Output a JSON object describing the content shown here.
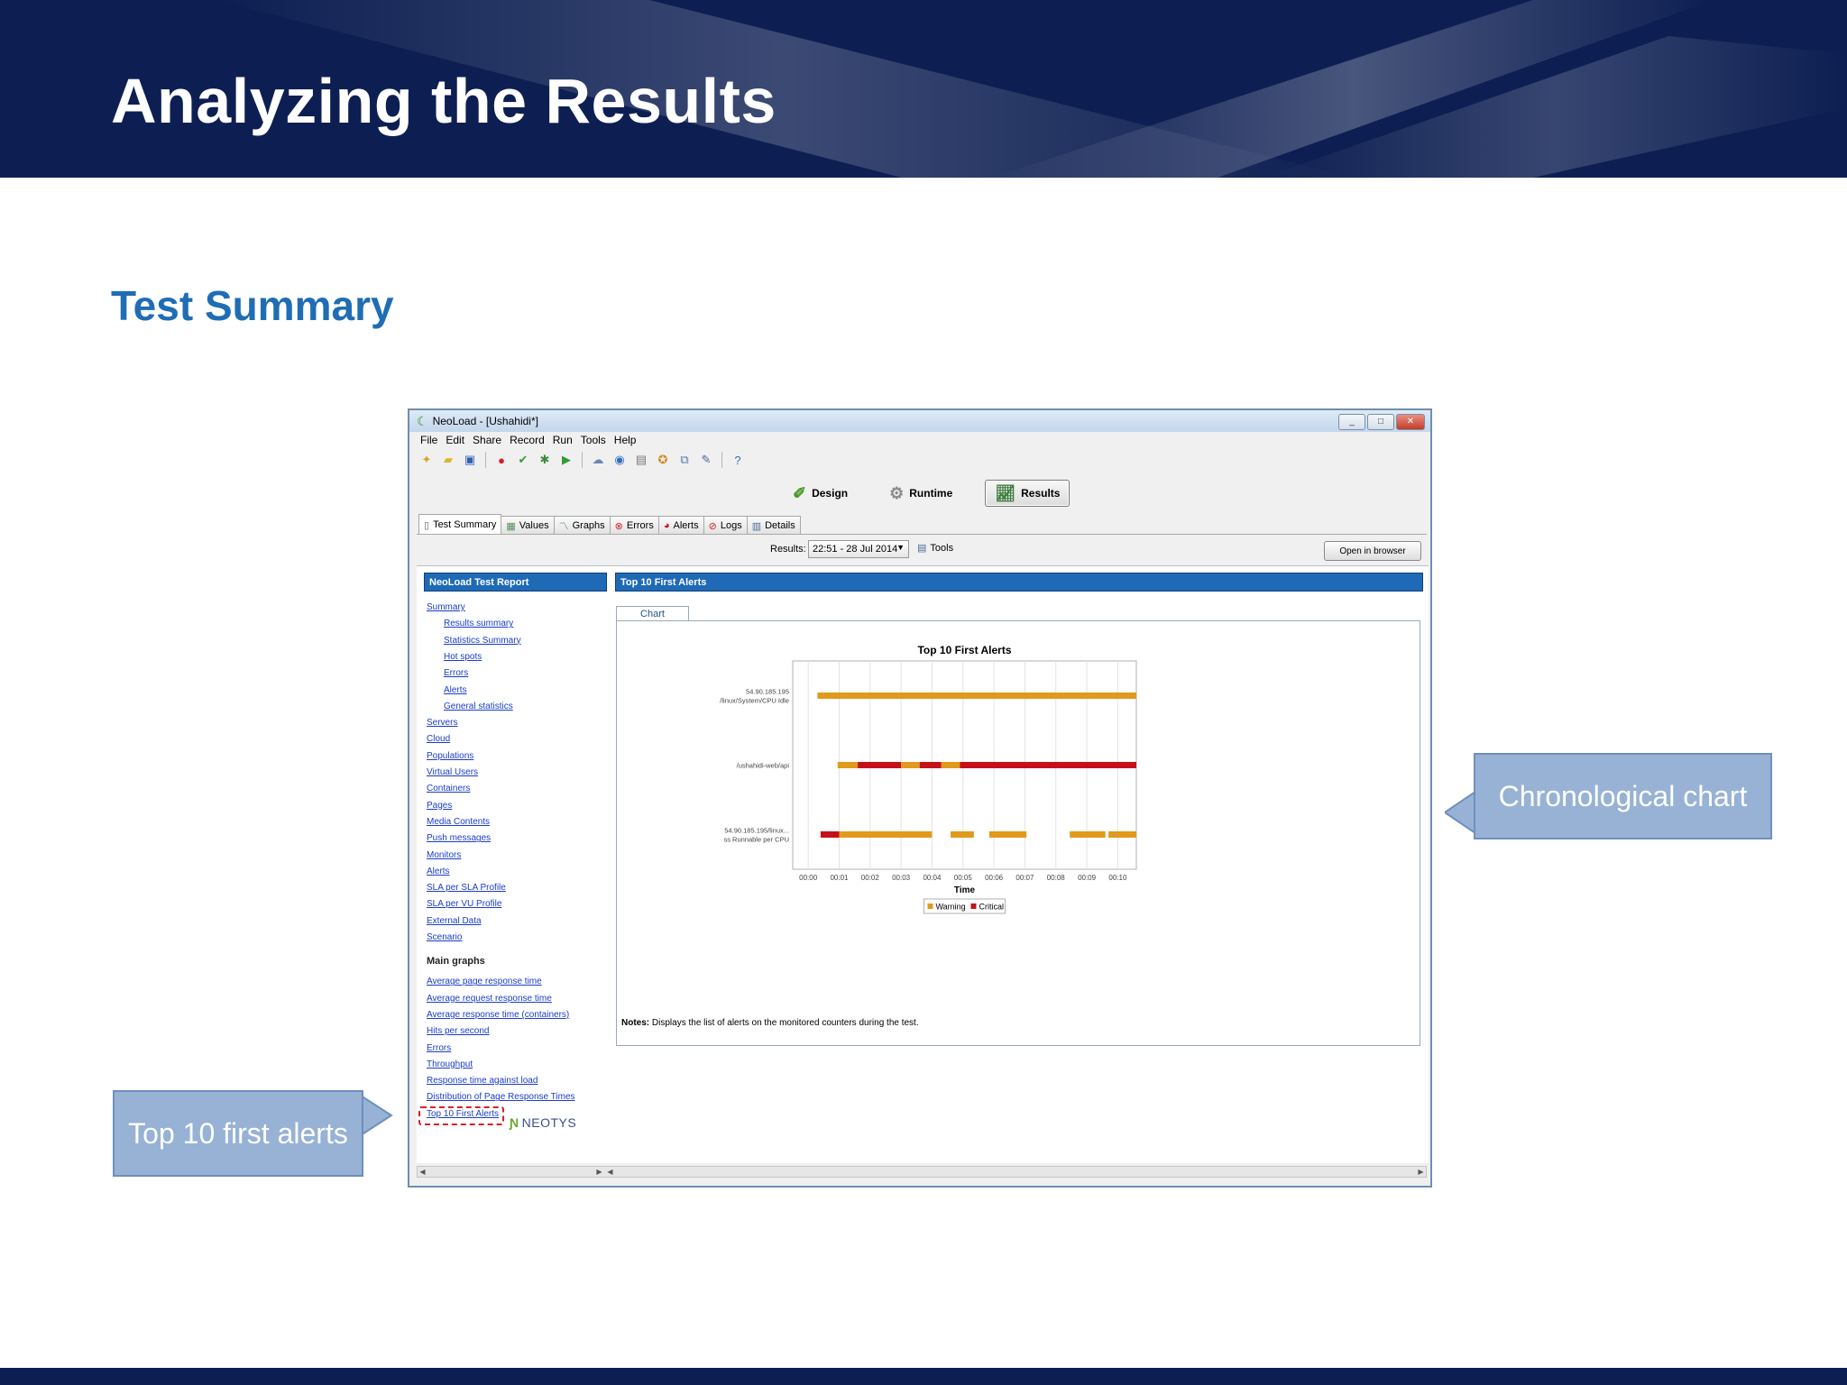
{
  "slide": {
    "title": "Analyzing the Results",
    "subtitle": "Test Summary",
    "callout_right": "Chronological chart",
    "callout_left": "Top 10 first alerts"
  },
  "window": {
    "title": "NeoLoad - [Ushahidi*]",
    "controls": [
      "_",
      "□",
      "✕"
    ]
  },
  "menu": [
    "File",
    "Edit",
    "Share",
    "Record",
    "Run",
    "Tools",
    "Help"
  ],
  "toolbar_icons": [
    "new-icon",
    "open-icon",
    "save-icon",
    "record-icon",
    "check-icon",
    "settings-icon",
    "play-icon",
    "cloud-icon",
    "globe-icon",
    "report-icon",
    "ribbon-icon",
    "compare-icon",
    "edit-icon",
    "help-icon"
  ],
  "modes": {
    "design": "Design",
    "runtime": "Runtime",
    "results": "Results"
  },
  "tabs": [
    "Test Summary",
    "Values",
    "Graphs",
    "Errors",
    "Alerts",
    "Logs",
    "Details"
  ],
  "results_bar": {
    "label": "Results:",
    "selected": "22:51 - 28 Jul 2014",
    "tools": "Tools",
    "open_browser": "Open in browser"
  },
  "left_panel": {
    "header": "NeoLoad Test Report",
    "nav": [
      {
        "label": "Summary",
        "sub": false
      },
      {
        "label": "Results summary",
        "sub": true
      },
      {
        "label": "Statistics Summary",
        "sub": true
      },
      {
        "label": "Hot spots",
        "sub": true
      },
      {
        "label": "Errors",
        "sub": true
      },
      {
        "label": "Alerts",
        "sub": true
      },
      {
        "label": "General statistics",
        "sub": true
      },
      {
        "label": "Servers",
        "sub": false
      },
      {
        "label": "Cloud",
        "sub": false
      },
      {
        "label": "Populations",
        "sub": false
      },
      {
        "label": "Virtual Users",
        "sub": false
      },
      {
        "label": "Containers",
        "sub": false
      },
      {
        "label": "Pages",
        "sub": false
      },
      {
        "label": "Media Contents",
        "sub": false
      },
      {
        "label": "Push messages",
        "sub": false
      },
      {
        "label": "Monitors",
        "sub": false
      },
      {
        "label": "Alerts",
        "sub": false
      },
      {
        "label": "SLA per SLA Profile",
        "sub": false
      },
      {
        "label": "SLA per VU Profile",
        "sub": false
      },
      {
        "label": "External Data",
        "sub": false
      },
      {
        "label": "Scenario",
        "sub": false
      }
    ],
    "main_graphs_heading": "Main graphs",
    "main_graphs": [
      "Average page response time",
      "Average request response time",
      "Average response time (containers)",
      "Hits per second",
      "Errors",
      "Throughput",
      "Response time against load",
      "Distribution of Page Response Times",
      "Top 10 First Alerts"
    ],
    "logo": "NEOTYS"
  },
  "right_panel": {
    "header": "Top 10 First Alerts",
    "chart_tab": "Chart",
    "notes_label": "Notes:",
    "notes_text": "Displays the list of alerts on the monitored counters during the test."
  },
  "colors": {
    "warning": "#e09a1c",
    "critical": "#c4111a",
    "panel_header": "#1f6ab7",
    "link": "#1a3ccc"
  },
  "chart_data": {
    "type": "timeline",
    "title": "Top 10 First Alerts",
    "xlabel": "Time",
    "x_ticks": [
      "00:00",
      "00:01",
      "00:02",
      "00:03",
      "00:04",
      "00:05",
      "00:06",
      "00:07",
      "00:08",
      "00:09",
      "00:10"
    ],
    "xlim": [
      -0.5,
      10.6
    ],
    "legend": [
      "Warning",
      "Critical"
    ],
    "legend_position": "bottom",
    "rows": [
      {
        "label_lines": [
          "54.90.185.195",
          "/linux/System/CPU Idle"
        ],
        "segments": [
          {
            "start": 0.3,
            "end": 10.6,
            "level": "Warning"
          }
        ]
      },
      {
        "label_lines": [
          "/ushahidi-web/api"
        ],
        "segments": [
          {
            "start": 0.95,
            "end": 1.6,
            "level": "Warning"
          },
          {
            "start": 1.6,
            "end": 3.0,
            "level": "Critical"
          },
          {
            "start": 3.0,
            "end": 3.6,
            "level": "Warning"
          },
          {
            "start": 3.6,
            "end": 4.3,
            "level": "Critical"
          },
          {
            "start": 4.3,
            "end": 4.9,
            "level": "Warning"
          },
          {
            "start": 4.9,
            "end": 10.6,
            "level": "Critical"
          }
        ]
      },
      {
        "label_lines": [
          "54.90.185.195/linux...",
          "ss Runnable per CPU"
        ],
        "segments": [
          {
            "start": 0.4,
            "end": 1.0,
            "level": "Critical"
          },
          {
            "start": 1.0,
            "end": 4.0,
            "level": "Warning"
          },
          {
            "start": 4.6,
            "end": 5.35,
            "level": "Warning"
          },
          {
            "start": 5.85,
            "end": 7.05,
            "level": "Warning"
          },
          {
            "start": 8.45,
            "end": 9.6,
            "level": "Warning"
          },
          {
            "start": 9.7,
            "end": 10.6,
            "level": "Warning"
          }
        ]
      }
    ]
  }
}
